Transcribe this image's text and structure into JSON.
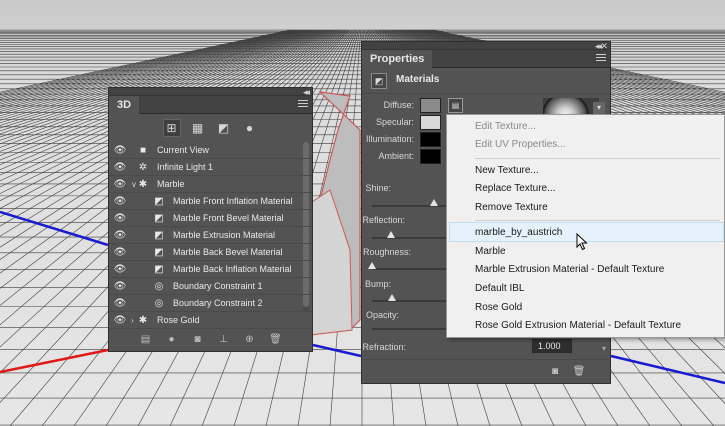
{
  "panel3d": {
    "title": "3D",
    "toolbar": [
      "scene-icon",
      "mesh-icon",
      "materials-icon",
      "lights-icon"
    ],
    "rows": [
      {
        "label": "Current View",
        "icon": "camera-icon"
      },
      {
        "label": "Infinite Light 1",
        "icon": "light-icon"
      },
      {
        "label": "Marble",
        "icon": "mesh-icon",
        "expanded": true
      },
      {
        "label": "Marble Front Inflation Material",
        "icon": "material-icon"
      },
      {
        "label": "Marble Front Bevel Material",
        "icon": "material-icon",
        "selected": true
      },
      {
        "label": "Marble Extrusion Material",
        "icon": "material-icon",
        "selected": true
      },
      {
        "label": "Marble Back Bevel Material",
        "icon": "material-icon",
        "selected": true
      },
      {
        "label": "Marble Back Inflation Material",
        "icon": "material-icon",
        "selected": true
      },
      {
        "label": "Boundary Constraint 1",
        "icon": "constraint-icon"
      },
      {
        "label": "Boundary Constraint 2",
        "icon": "constraint-icon"
      },
      {
        "label": "Rose Gold",
        "icon": "mesh-icon",
        "expanded": false
      }
    ]
  },
  "properties": {
    "title": "Properties",
    "section": "Materials",
    "labels": {
      "diffuse": "Diffuse:",
      "specular": "Specular:",
      "illumination": "Illumination:",
      "ambient": "Ambient:",
      "shine": "Shine:",
      "reflection": "Reflection:",
      "roughness": "Roughness:",
      "bump": "Bump:",
      "opacity": "Opacity:",
      "refraction": "Refraction:"
    },
    "refraction_value": "1.000",
    "colors": {
      "diffuse": "#8a8a8a",
      "specular": "#d8d8d8",
      "illumination": "#000000",
      "ambient": "#000000"
    }
  },
  "dropdown": {
    "group1": [
      "Edit Texture...",
      "Edit UV Properties..."
    ],
    "group2": [
      "New Texture...",
      "Replace Texture...",
      "Remove Texture"
    ],
    "group3": [
      "marble_by_austrich",
      "Marble",
      "Marble Extrusion Material - Default Texture",
      "Default IBL",
      "Rose Gold",
      "Rose Gold Extrusion Material - Default Texture"
    ]
  }
}
